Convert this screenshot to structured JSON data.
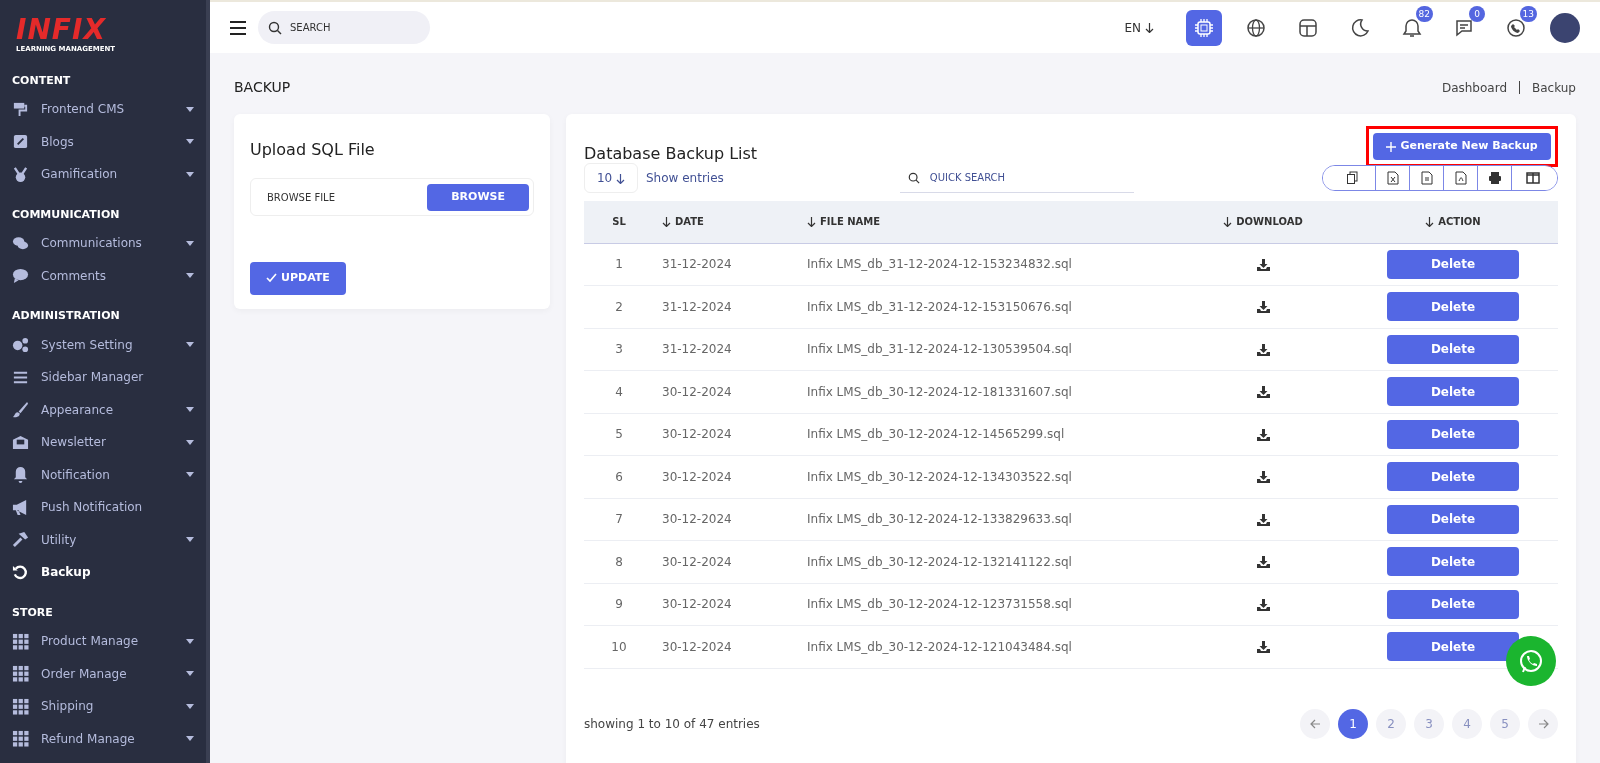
{
  "sidebar": {
    "logo": "INFIX",
    "logo_tagline": "LEARNING MANAGEMENT",
    "sections": [
      {
        "title": "CONTENT",
        "items": [
          {
            "label": "Frontend CMS",
            "expandable": true,
            "selected": false
          },
          {
            "label": "Blogs",
            "expandable": true,
            "selected": false
          },
          {
            "label": "Gamification",
            "expandable": true,
            "selected": false
          }
        ]
      },
      {
        "title": "COMMUNICATION",
        "items": [
          {
            "label": "Communications",
            "expandable": true,
            "selected": false
          },
          {
            "label": "Comments",
            "expandable": true,
            "selected": false
          }
        ]
      },
      {
        "title": "ADMINISTRATION",
        "items": [
          {
            "label": "System Setting",
            "expandable": true,
            "selected": false
          },
          {
            "label": "Sidebar Manager",
            "expandable": false,
            "selected": false
          },
          {
            "label": "Appearance",
            "expandable": true,
            "selected": false
          },
          {
            "label": "Newsletter",
            "expandable": true,
            "selected": false
          },
          {
            "label": "Notification",
            "expandable": true,
            "selected": false
          },
          {
            "label": "Push Notification",
            "expandable": false,
            "selected": false
          },
          {
            "label": "Utility",
            "expandable": true,
            "selected": false
          },
          {
            "label": "Backup",
            "expandable": false,
            "selected": true
          }
        ]
      },
      {
        "title": "STORE",
        "items": [
          {
            "label": "Product Manage",
            "expandable": true,
            "selected": false
          },
          {
            "label": "Order Manage",
            "expandable": true,
            "selected": false
          },
          {
            "label": "Shipping",
            "expandable": true,
            "selected": false
          },
          {
            "label": "Refund Manage",
            "expandable": true,
            "selected": false
          }
        ]
      }
    ]
  },
  "topbar": {
    "search": {
      "placeholder": "SEARCH"
    },
    "language": "EN",
    "badges": [
      {
        "kind": "bell",
        "count": "82"
      },
      {
        "kind": "chat",
        "count": "0"
      },
      {
        "kind": "phone",
        "count": "13"
      }
    ]
  },
  "page_title": "BACKUP",
  "breadcrumb": [
    "Dashboard",
    "Backup"
  ],
  "upload_card": {
    "title": "Upload SQL File",
    "file_placeholder": "BROWSE FILE",
    "browse_button": "BROWSE",
    "update_button": "UPDATE"
  },
  "backup_list": {
    "title": "Database Backup List",
    "generate_button": "Generate New Backup",
    "page_size": "10",
    "show_entries": "Show entries",
    "search": {
      "placeholder": "QUICK SEARCH"
    },
    "table": {
      "columns": [
        {
          "label": "SL",
          "sortable": false
        },
        {
          "label": "DATE",
          "sortable": true
        },
        {
          "label": "FILE NAME",
          "sortable": true
        },
        {
          "label": "DOWNLOAD",
          "sortable": true
        },
        {
          "label": "ACTION",
          "sortable": true
        }
      ],
      "rows": [
        {
          "sl": "1",
          "date": "31-12-2024",
          "file": "Infix LMS_db_31-12-2024-12-153234832.sql",
          "action": "Delete"
        },
        {
          "sl": "2",
          "date": "31-12-2024",
          "file": "Infix LMS_db_31-12-2024-12-153150676.sql",
          "action": "Delete"
        },
        {
          "sl": "3",
          "date": "31-12-2024",
          "file": "Infix LMS_db_31-12-2024-12-130539504.sql",
          "action": "Delete"
        },
        {
          "sl": "4",
          "date": "30-12-2024",
          "file": "Infix LMS_db_30-12-2024-12-181331607.sql",
          "action": "Delete"
        },
        {
          "sl": "5",
          "date": "30-12-2024",
          "file": "Infix LMS_db_30-12-2024-12-14565299.sql",
          "action": "Delete"
        },
        {
          "sl": "6",
          "date": "30-12-2024",
          "file": "Infix LMS_db_30-12-2024-12-134303522.sql",
          "action": "Delete"
        },
        {
          "sl": "7",
          "date": "30-12-2024",
          "file": "Infix LMS_db_30-12-2024-12-133829633.sql",
          "action": "Delete"
        },
        {
          "sl": "8",
          "date": "30-12-2024",
          "file": "Infix LMS_db_30-12-2024-12-132141122.sql",
          "action": "Delete"
        },
        {
          "sl": "9",
          "date": "30-12-2024",
          "file": "Infix LMS_db_30-12-2024-12-123731558.sql",
          "action": "Delete"
        },
        {
          "sl": "10",
          "date": "30-12-2024",
          "file": "Infix LMS_db_30-12-2024-12-121043484.sql",
          "action": "Delete"
        }
      ]
    },
    "summary": "showing 1 to 10 of 47 entries",
    "pages": [
      {
        "label": "1",
        "selected": true
      },
      {
        "label": "2",
        "selected": false
      },
      {
        "label": "3",
        "selected": false
      },
      {
        "label": "4",
        "selected": false
      },
      {
        "label": "5",
        "selected": false
      }
    ]
  }
}
